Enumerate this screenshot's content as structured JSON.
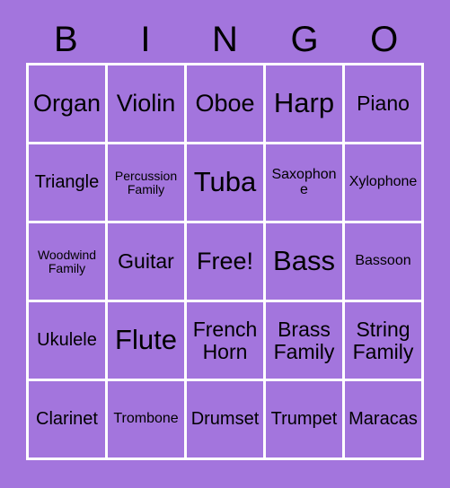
{
  "card": {
    "header_letters": [
      "B",
      "I",
      "N",
      "G",
      "O"
    ],
    "colors": {
      "background": "#a375dd",
      "cell_background": "#a375dd",
      "grid_line": "#ffffff",
      "text": "#000000"
    },
    "grid": {
      "rows": 5,
      "columns": 5,
      "cells": [
        {
          "text": "Organ",
          "size": "lg"
        },
        {
          "text": "Violin",
          "size": "lg"
        },
        {
          "text": "Oboe",
          "size": "lg"
        },
        {
          "text": "Harp",
          "size": "xl"
        },
        {
          "text": "Piano",
          "size": "md"
        },
        {
          "text": "Triangle",
          "size": "sm"
        },
        {
          "text": "Percussion Family",
          "size": "xxs"
        },
        {
          "text": "Tuba",
          "size": "xl"
        },
        {
          "text": "Saxophone",
          "size": "xs"
        },
        {
          "text": "Xylophone",
          "size": "xs"
        },
        {
          "text": "Woodwind Family",
          "size": "xxs"
        },
        {
          "text": "Guitar",
          "size": "md"
        },
        {
          "text": "Free!",
          "size": "lg"
        },
        {
          "text": "Bass",
          "size": "xl"
        },
        {
          "text": "Bassoon",
          "size": "xs"
        },
        {
          "text": "Ukulele",
          "size": "sm"
        },
        {
          "text": "Flute",
          "size": "xl"
        },
        {
          "text": "French Horn",
          "size": "md"
        },
        {
          "text": "Brass Family",
          "size": "md"
        },
        {
          "text": "String Family",
          "size": "md"
        },
        {
          "text": "Clarinet",
          "size": "sm"
        },
        {
          "text": "Trombone",
          "size": "xs"
        },
        {
          "text": "Drumset",
          "size": "sm"
        },
        {
          "text": "Trumpet",
          "size": "sm"
        },
        {
          "text": "Maracas",
          "size": "sm"
        }
      ]
    }
  }
}
